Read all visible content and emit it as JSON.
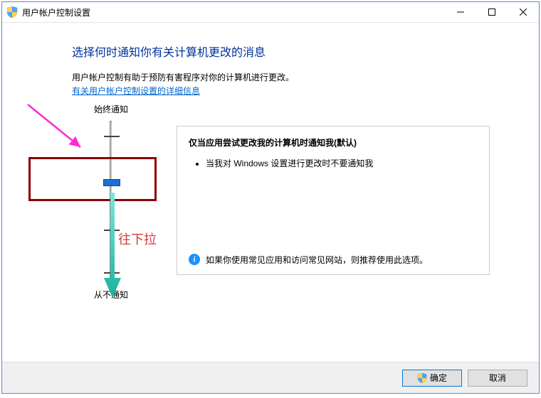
{
  "window": {
    "title": "用户帐户控制设置"
  },
  "heading": "选择何时通知你有关计算机更改的消息",
  "description": "用户帐户控制有助于预防有害程序对你的计算机进行更改。",
  "help_link": "有关用户帐户控制设置的详细信息",
  "slider": {
    "top_label": "始终通知",
    "bottom_label": "从不通知"
  },
  "detail": {
    "title": "仅当应用尝试更改我的计算机时通知我(默认)",
    "bullets": [
      "当我对 Windows 设置进行更改时不要通知我"
    ],
    "recommendation": "如果你使用常见应用和访问常见网站，则推荐使用此选项。"
  },
  "footer": {
    "ok": "确定",
    "cancel": "取消"
  },
  "annotations": {
    "pull_down": "往下拉"
  }
}
